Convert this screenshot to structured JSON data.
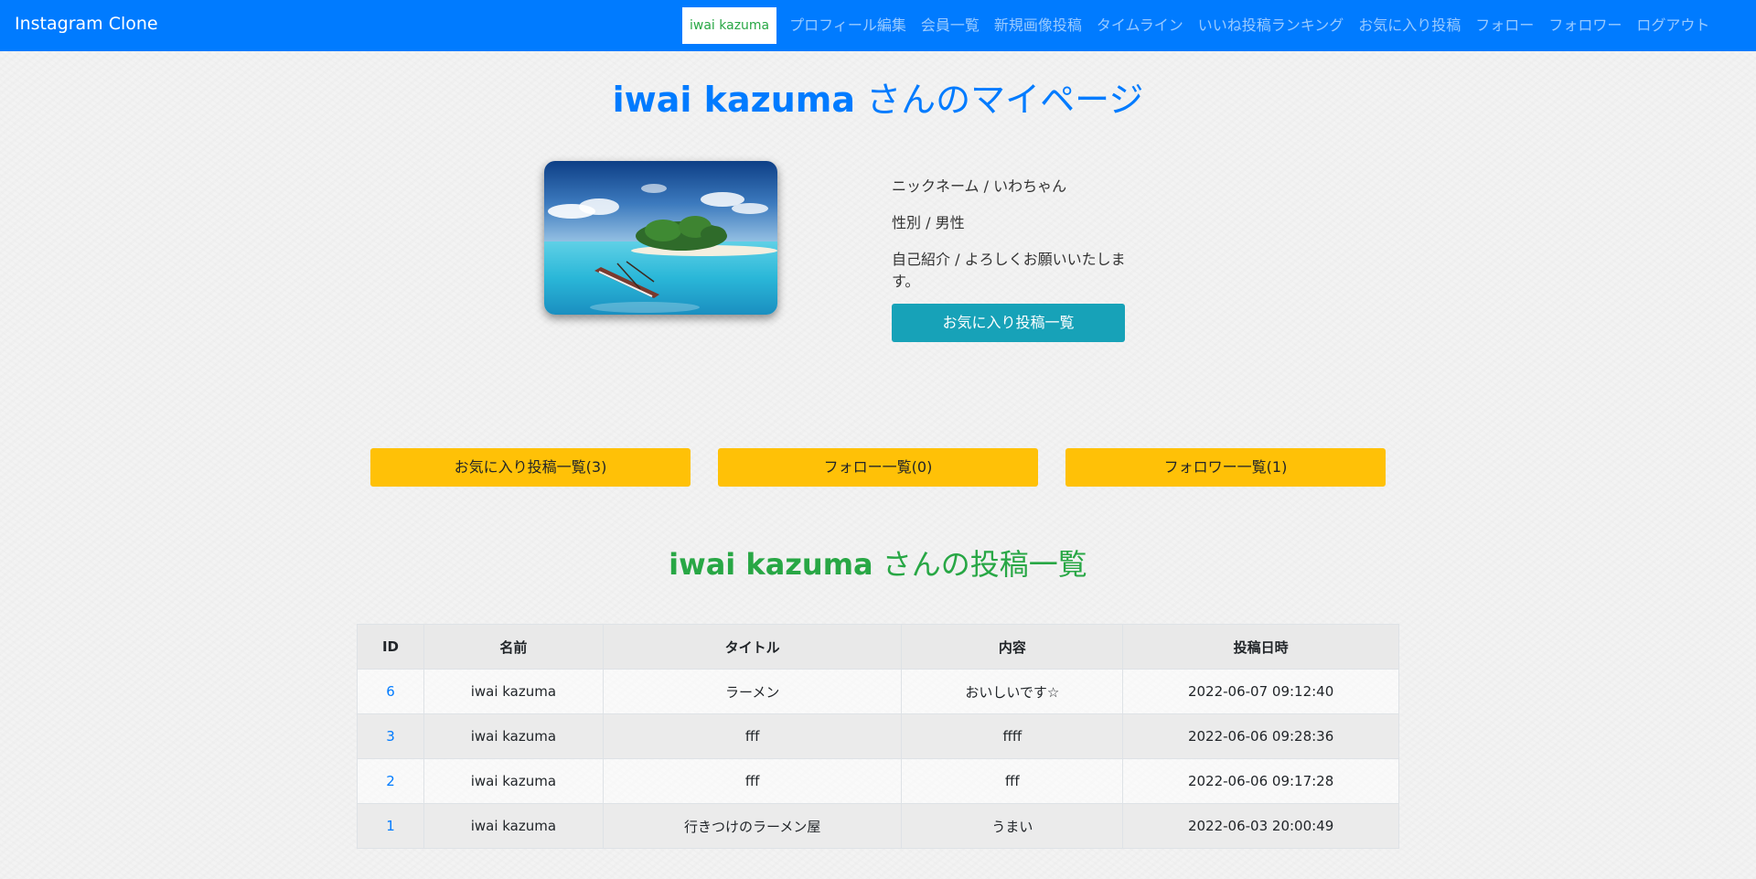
{
  "nav": {
    "brand": "Instagram Clone",
    "current_user": "iwai kazuma",
    "links": [
      "プロフィール編集",
      "会員一覧",
      "新規画像投稿",
      "タイムライン",
      "いいね投稿ランキング",
      "お気に入り投稿",
      "フォロー",
      "フォロワー",
      "ログアウト"
    ]
  },
  "header": {
    "user_name": "iwai kazuma",
    "title_suffix": " さんのマイページ"
  },
  "profile": {
    "nickname": "ニックネーム / いわちゃん",
    "gender": "性別 / 男性",
    "bio": "自己紹介 / よろしくお願いいたします。",
    "favorites_button": "お気に入り投稿一覧"
  },
  "actions": {
    "favorites": "お気に入り投稿一覧(3)",
    "following": "フォロー一覧(0)",
    "followers": "フォロワー一覧(1)"
  },
  "posts_section": {
    "user_name": "iwai kazuma",
    "title_suffix": " さんの投稿一覧"
  },
  "table": {
    "headers": [
      "ID",
      "名前",
      "タイトル",
      "内容",
      "投稿日時"
    ],
    "rows": [
      [
        "6",
        "iwai kazuma",
        "ラーメン",
        "おいしいです☆",
        "2022-06-07 09:12:40"
      ],
      [
        "3",
        "iwai kazuma",
        "fff",
        "ffff",
        "2022-06-06 09:28:36"
      ],
      [
        "2",
        "iwai kazuma",
        "fff",
        "fff",
        "2022-06-06 09:17:28"
      ],
      [
        "1",
        "iwai kazuma",
        "行きつけのラーメン屋",
        "うまい",
        "2022-06-03 20:00:49"
      ]
    ]
  },
  "colors": {
    "primary": "#007bff",
    "success": "#28a745",
    "info": "#17a2b8",
    "warning": "#ffc107"
  }
}
